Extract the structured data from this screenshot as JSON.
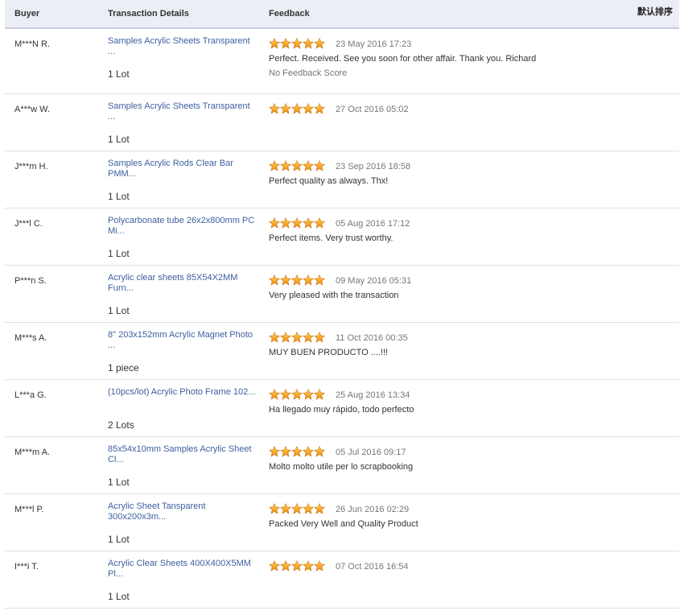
{
  "header": {
    "buyer": "Buyer",
    "details": "Transaction Details",
    "feedback": "Feedback",
    "sort": "默认排序"
  },
  "colors": {
    "link": "#3d5fa0",
    "star": "#f0a020",
    "header_bg": "#eceef5"
  },
  "rows": [
    {
      "buyer": "M***N R.",
      "product": "Samples Acrylic Sheets Transparent ...",
      "qty": "1 Lot",
      "rating": 5,
      "date": "23 May 2016 17:23",
      "comment": "Perfect. Received. See you soon for other affair. Thank you. Richard",
      "note": "No Feedback Score"
    },
    {
      "buyer": "A***w W.",
      "product": "Samples Acrylic Sheets Transparent ...",
      "qty": "1 Lot",
      "rating": 5,
      "date": "27 Oct 2016 05:02",
      "comment": "",
      "note": ""
    },
    {
      "buyer": "J***m H.",
      "product": "Samples Acrylic Rods Clear Bar\nPMM...",
      "qty": "1 Lot",
      "rating": 5,
      "date": "23 Sep 2016 18:58",
      "comment": "Perfect quality as always. Thx!",
      "note": ""
    },
    {
      "buyer": "J***l C.",
      "product": "Polycarbonate tube 26x2x800mm PC\nMi...",
      "qty": "1 Lot",
      "rating": 5,
      "date": "05 Aug 2016 17:12",
      "comment": "Perfect items. Very trust worthy.",
      "note": ""
    },
    {
      "buyer": "P***n S.",
      "product": "Acrylic clear sheets 85X54X2MM\nFurn...",
      "qty": "1 Lot",
      "rating": 5,
      "date": "09 May 2016 05:31",
      "comment": "Very pleased with the transaction",
      "note": ""
    },
    {
      "buyer": "M***s A.",
      "product": "8\" 203x152mm Acrylic Magnet Photo\n...",
      "qty": "1 piece",
      "rating": 5,
      "date": "11 Oct 2016 00:35",
      "comment": "MUY BUEN PRODUCTO ....!!!",
      "note": ""
    },
    {
      "buyer": "L***a G.",
      "product": "(10pcs/lot) Acrylic Photo Frame 102...",
      "qty": "2 Lots",
      "rating": 5,
      "date": "25 Aug 2016 13:34",
      "comment": "Ha llegado muy rápido, todo perfecto",
      "note": ""
    },
    {
      "buyer": "M***m A.",
      "product": "85x54x10mm Samples Acrylic Sheet\nCl...",
      "qty": "1 Lot",
      "rating": 5,
      "date": "05 Jul 2016 09:17",
      "comment": "Molto molto utile per lo scrapbooking",
      "note": ""
    },
    {
      "buyer": "M***l P.",
      "product": "Acrylic Sheet Tansparent\n300x200x3m...",
      "qty": "1 Lot",
      "rating": 5,
      "date": "26 Jun 2016 02:29",
      "comment": "Packed Very Well and Quality Product",
      "note": ""
    },
    {
      "buyer": "I***i T.",
      "product": "Acrylic Clear Sheets 400X400X5MM\nPl...",
      "qty": "1 Lot",
      "rating": 5,
      "date": "07 Oct 2016 16:54",
      "comment": "",
      "note": ""
    }
  ]
}
